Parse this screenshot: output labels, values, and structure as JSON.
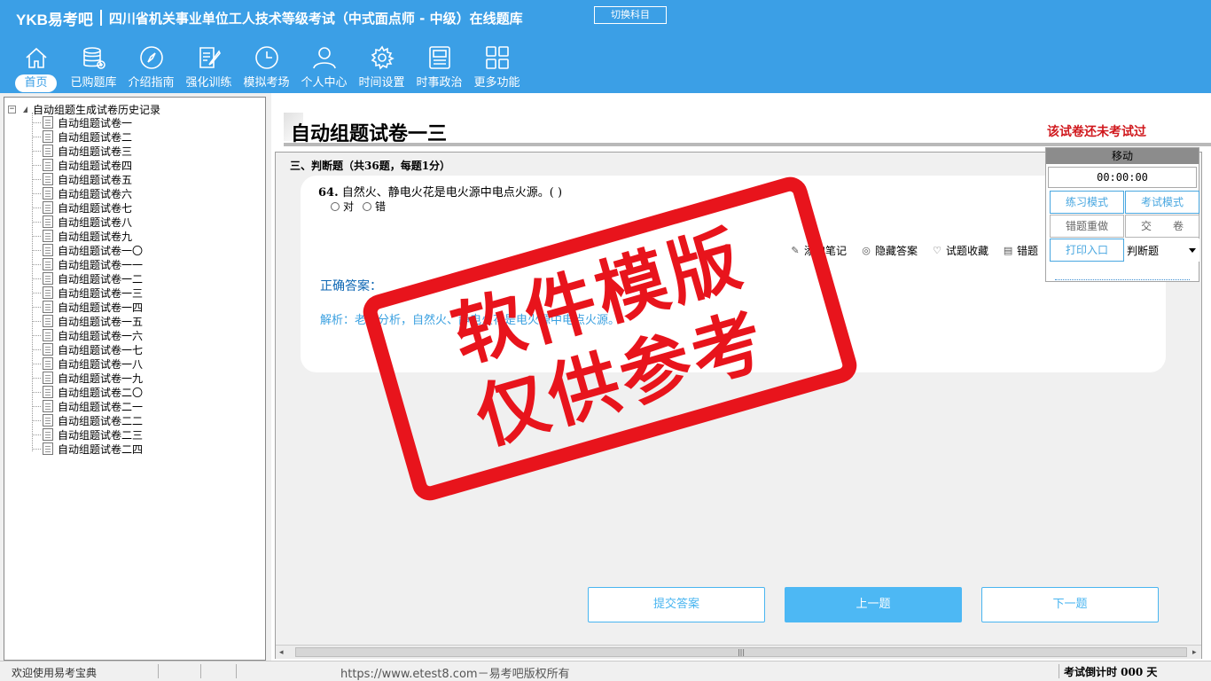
{
  "header": {
    "logo": "YKB易考吧",
    "title": "四川省机关事业单位工人技术等级考试（中式面点师 - 中级）在线题库",
    "switch_subject": "切换科目"
  },
  "nav": {
    "items": [
      {
        "label": "首页",
        "icon": "home-icon"
      },
      {
        "label": "已购题库",
        "icon": "database-icon"
      },
      {
        "label": "介绍指南",
        "icon": "compass-icon"
      },
      {
        "label": "强化训练",
        "icon": "edit-icon"
      },
      {
        "label": "模拟考场",
        "icon": "clock-icon"
      },
      {
        "label": "个人中心",
        "icon": "user-icon"
      },
      {
        "label": "时间设置",
        "icon": "gear-icon"
      },
      {
        "label": "时事政治",
        "icon": "news-icon"
      },
      {
        "label": "更多功能",
        "icon": "grid-icon"
      }
    ]
  },
  "tree": {
    "root": "自动组题生成试卷历史记录",
    "items": [
      "自动组题试卷一",
      "自动组题试卷二",
      "自动组题试卷三",
      "自动组题试卷四",
      "自动组题试卷五",
      "自动组题试卷六",
      "自动组题试卷七",
      "自动组题试卷八",
      "自动组题试卷九",
      "自动组题试卷一〇",
      "自动组题试卷一一",
      "自动组题试卷一二",
      "自动组题试卷一三",
      "自动组题试卷一四",
      "自动组题试卷一五",
      "自动组题试卷一六",
      "自动组题试卷一七",
      "自动组题试卷一八",
      "自动组题试卷一九",
      "自动组题试卷二〇",
      "自动组题试卷二一",
      "自动组题试卷二二",
      "自动组题试卷二三",
      "自动组题试卷二四"
    ]
  },
  "paper": {
    "title": "自动组题试卷一三",
    "status": "该试卷还未考试过",
    "section": "三、判断题（共36题，每题1分）"
  },
  "question": {
    "number": "64.",
    "text": "自然火、静电火花是电火源中电点火源。( )",
    "options": [
      "对",
      "错"
    ],
    "tools": [
      "添加笔记",
      "隐藏答案",
      "试题收藏",
      "错题"
    ],
    "answer_label": "正确答案：",
    "analysis": "解析：老师分析，自然火、静电火花是电火源中电点火源。"
  },
  "buttons": {
    "submit": "提交答案",
    "prev": "上一题",
    "next": "下一题"
  },
  "float_panel": {
    "move": "移动",
    "timer": "00:00:00",
    "practice": "练习模式",
    "exam": "考试模式",
    "redo_wrong": "错题重做",
    "hand_in": "交　　卷",
    "print": "打印入口",
    "type_select": "判断题"
  },
  "watermark": {
    "line1": "软件模版",
    "line2": "仅供参考"
  },
  "status": {
    "welcome": "欢迎使用易考宝典",
    "copyright": "https://www.etest8.com－易考吧版权所有",
    "countdown": "考试倒计时 000 天"
  },
  "colors": {
    "brand": "#3b9fe6",
    "accent": "#49b5f0",
    "alert": "#d0181d",
    "stamp": "#e8141c"
  }
}
